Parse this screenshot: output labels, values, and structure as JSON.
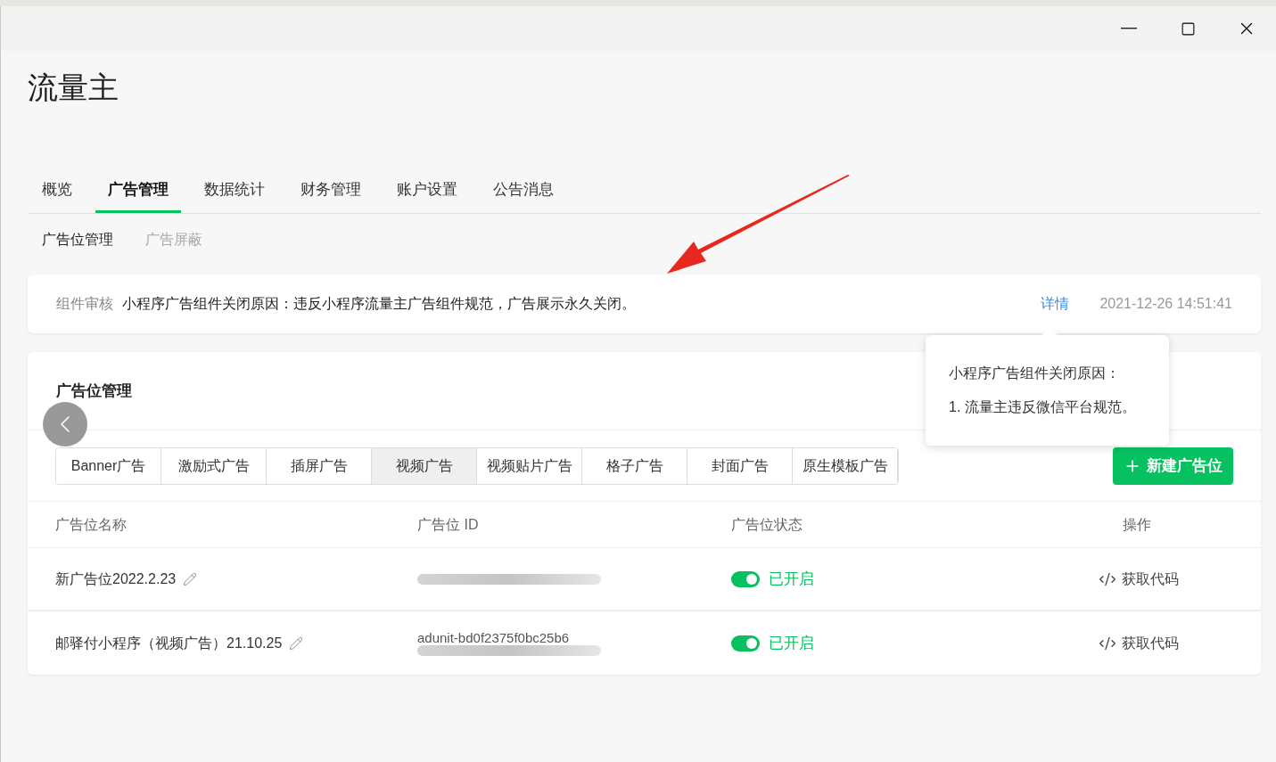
{
  "window": {
    "title": "流量主"
  },
  "tabs": [
    {
      "label": "概览",
      "selected": false
    },
    {
      "label": "广告管理",
      "selected": true
    },
    {
      "label": "数据统计",
      "selected": false
    },
    {
      "label": "财务管理",
      "selected": false
    },
    {
      "label": "账户设置",
      "selected": false
    },
    {
      "label": "公告消息",
      "selected": false
    }
  ],
  "sub_tabs": [
    {
      "label": "广告位管理",
      "selected": true
    },
    {
      "label": "广告屏蔽",
      "selected": false
    }
  ],
  "notice": {
    "tag": "组件审核",
    "message": "小程序广告组件关闭原因：违反小程序流量主广告组件规范，广告展示永久关闭。",
    "link": "详情",
    "time": "2021-12-26 14:51:41"
  },
  "tooltip": {
    "lines": [
      "小程序广告组件关闭原因：",
      "1. 流量主违反微信平台规范。"
    ]
  },
  "panel": {
    "title": "广告位管理",
    "ad_types": [
      {
        "label": "Banner广告",
        "selected": false
      },
      {
        "label": "激励式广告",
        "selected": false
      },
      {
        "label": "插屏广告",
        "selected": false
      },
      {
        "label": "视频广告",
        "selected": true
      },
      {
        "label": "视频贴片广告",
        "selected": false
      },
      {
        "label": "格子广告",
        "selected": false
      },
      {
        "label": "封面广告",
        "selected": false
      },
      {
        "label": "原生模板广告",
        "selected": false
      }
    ],
    "new_button": "新建广告位",
    "table": {
      "columns": [
        "广告位名称",
        "广告位 ID",
        "广告位状态",
        "操作"
      ],
      "rows": [
        {
          "name": "新广告位2022.2.23",
          "id": "",
          "on": true,
          "status": "已开启",
          "action": "获取代码"
        },
        {
          "name": "邮驿付小程序（视频广告）21.10.25",
          "id": "adunit-bd0f2375f0bc25b6",
          "on": true,
          "status": "已开启",
          "action": "获取代码"
        }
      ]
    }
  }
}
